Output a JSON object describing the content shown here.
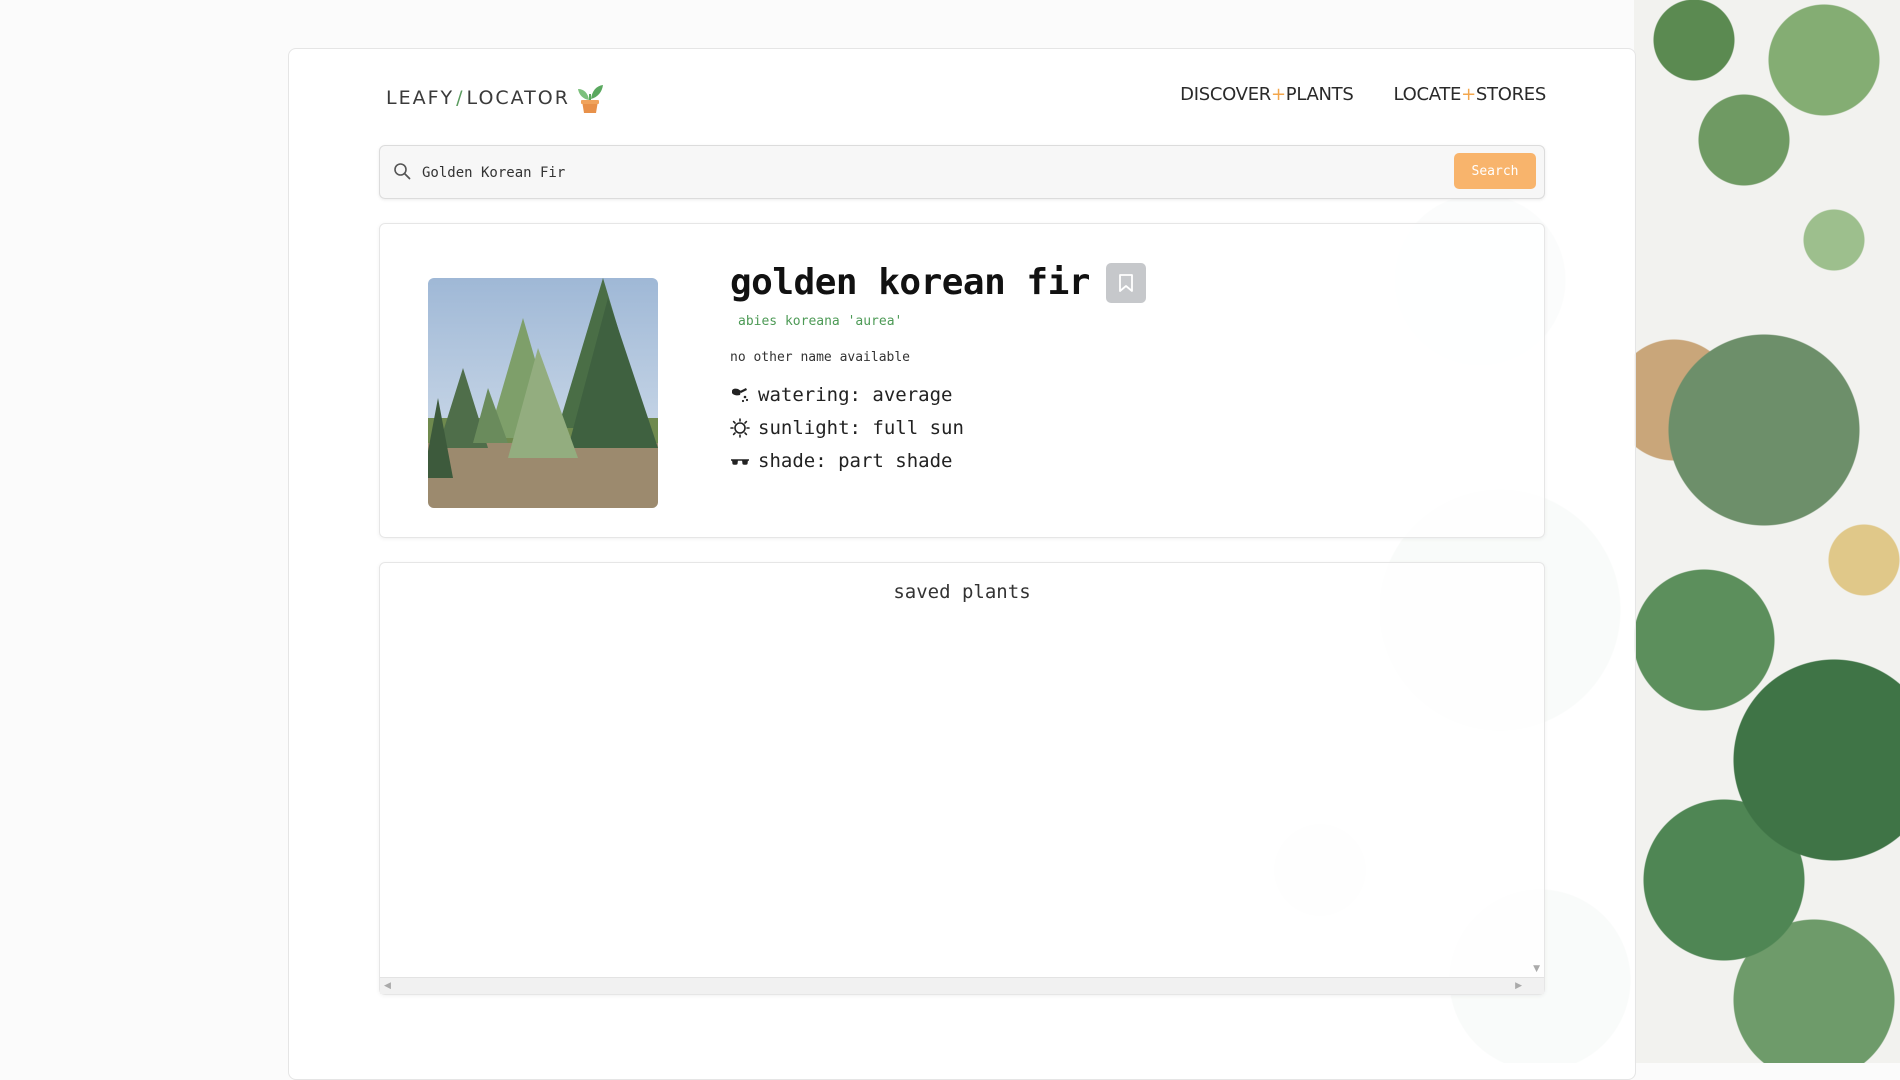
{
  "brand": {
    "name_left": "LEAFY",
    "slash": "/",
    "name_right": "LOCATOR"
  },
  "nav": [
    {
      "left": "DISCOVER",
      "plus": "+",
      "right": "PLANTS"
    },
    {
      "left": "LOCATE",
      "plus": "+",
      "right": "STORES"
    }
  ],
  "search": {
    "value": "Golden Korean Fir",
    "button_label": "Search"
  },
  "plant": {
    "common_name": "golden korean fir",
    "scientific_name": "abies koreana 'aurea'",
    "other_name": "no other name available",
    "watering": "watering: average",
    "sunlight": "sunlight: full sun",
    "shade": "shade: part shade"
  },
  "saved": {
    "title": "saved plants"
  },
  "colors": {
    "accent_orange": "#f8b46c",
    "accent_green": "#4d9a56",
    "bookmark_bg": "#c6c8cb"
  },
  "icons": {
    "logo": "potted-sprout-icon",
    "search": "magnifier-icon",
    "bookmark": "bookmark-icon",
    "watering": "watering-can-icon",
    "sunlight": "sun-icon",
    "shade": "sunglasses-icon"
  }
}
